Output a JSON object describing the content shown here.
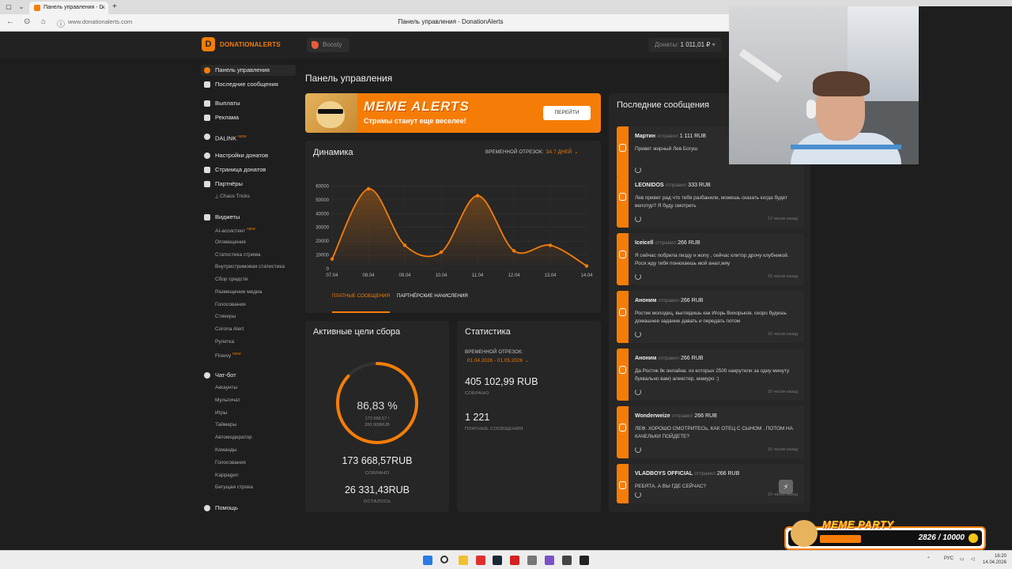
{
  "browser": {
    "tab_title": "Панель управления - D",
    "url": "www.donationalerts.com",
    "page_title": "Панель управления - DonationAlerts"
  },
  "topnav": {
    "logo": "DONATIONALERTS",
    "boosty": "Boosty",
    "donates_label": "Донаты:",
    "donates_value": "1 011,01 ₽"
  },
  "sidebar": {
    "items": [
      {
        "label": "Панель управления"
      },
      {
        "label": "Последние сообщения"
      },
      {
        "label": "Выплаты"
      },
      {
        "label": "Реклама"
      },
      {
        "label": "DALINK"
      },
      {
        "label": "Настройки донатов"
      },
      {
        "label": "Страница донатов"
      },
      {
        "label": "Партнёры"
      },
      {
        "label": "Виджеты"
      },
      {
        "label": "Чат-бот"
      },
      {
        "label": "Помощь"
      }
    ],
    "partners_sub": [
      "Chaos Tricks"
    ],
    "widgets_sub": [
      "AI-ассистент",
      "Оповещения",
      "Статистика стрима",
      "Внутристримовая статистика",
      "Сбор средств",
      "Размещение медиа",
      "Голосования",
      "Стикеры",
      "Corona Alert",
      "Рулетка",
      "Flowvy"
    ],
    "chatbot_sub": [
      "Аккаунты",
      "Мультичат",
      "Игры",
      "Таймеры",
      "Автомодератор",
      "Команды",
      "Голосования",
      "Kappagen",
      "Бегущая строка"
    ],
    "new_badge": "NEW"
  },
  "main": {
    "title": "Панель управления",
    "banner": {
      "title": "MEME ALERTS",
      "subtitle": "Стримы станут еще веселее!",
      "button": "ПЕРЕЙТИ"
    },
    "dynamics": {
      "title": "Динамика",
      "period_label": "ВРЕМЕННОЙ ОТРЕЗОК:",
      "period_value": "ЗА 7 ДНЕЙ",
      "tab_paid": "ПЛАТНЫЕ СООБЩЕНИЯ",
      "tab_partner": "ПАРТНЁРСКИЕ НАЧИСЛЕНИЯ"
    },
    "goals": {
      "title": "Активные цели сбора",
      "percent": "86,83 %",
      "progress": 0.8683,
      "ring_line1": "173 668,57 /",
      "ring_line2": "200 000RUB",
      "collected": "173 668,57RUB",
      "collected_label": "СОБРАНО",
      "left": "26 331,43RUB",
      "left_label": "ОСТАЛОСЬ"
    },
    "stats": {
      "title": "Статистика",
      "period_label": "ВРЕМЕННОЙ ОТРЕЗОК:",
      "period_value": "01.04.2026 - 01.05.2026",
      "collected": "405 102,99 RUB",
      "collected_label": "СОБРАНО",
      "messages": "1 221",
      "messages_label": "ПЛАТНЫЕ СООБЩЕНИЯ"
    }
  },
  "recent": {
    "title": "Последние сообщения",
    "verb": "отправил",
    "messages": [
      {
        "name": "Мартин",
        "amount": "1 111 RUB",
        "text": "Привет жирный Лев Богуш",
        "time": ""
      },
      {
        "name": "LEONIDOS",
        "amount": "333 RUB",
        "text": "Лев привет рад что тебя разбанили, можешь сказать когда будет велотур? Я буду смотреть",
        "time": "13 часов назад"
      },
      {
        "name": "Iceicell",
        "amount": "266 RUB",
        "text": "Я сейчас побрила пизду и жопу , сейчас клитор дрочу клубникой. Рося жду тебя понюхаешь мой анал,мяу",
        "time": "15 часов назад"
      },
      {
        "name": "Аноним",
        "amount": "266 RUB",
        "text": "Ростик молодец, выглядишь как Игорь Вихорьков. скоро будешь домашнее задание давать и передать потом",
        "time": "16 часов назад"
      },
      {
        "name": "Аноним",
        "amount": "266 RUB",
        "text": "Да Ростик 8к онлайна. из которых 2500 накрутили за одну минуту буквально вам) алекстер, мамуро :)",
        "time": "16 часов назад"
      },
      {
        "name": "Wonderweize",
        "amount": "266 RUB",
        "text": "ЛЕФ. ХОРОШО СМОТРИТЕСЬ, КАК ОТЕЦ С СЫНОМ . ПОТОМ НА КАЧЕЛЬКИ ПОЙДЕТЕ?",
        "time": "16 часов назад"
      },
      {
        "name": "VLADBOYS OFFICIAL",
        "amount": "266 RUB",
        "text": "РЕБЯТА, А ВЫ ГДЕ СЕЙЧАС?",
        "time": "16 часов назад"
      }
    ]
  },
  "overlay": {
    "title": "MEME PARTY",
    "count": "2826 / 10000",
    "progress": 0.2826
  },
  "taskbar": {
    "lang": "РУС",
    "time": "16:20",
    "date": "14.04.2026"
  },
  "chart_data": {
    "type": "line",
    "title": "Динамика",
    "categories": [
      "07.04",
      "08.04",
      "09.04",
      "10.04",
      "11.04",
      "12.04",
      "13.04",
      "14.04"
    ],
    "values": [
      7000,
      58000,
      17000,
      12000,
      53000,
      13000,
      17000,
      2000
    ],
    "yticks": [
      0,
      10000,
      20000,
      30000,
      40000,
      50000,
      60000
    ],
    "ylim": [
      0,
      62000
    ],
    "grid": true,
    "color": "#f57d07"
  },
  "colors": {
    "accent": "#f57d07",
    "background": "#1e1e1e",
    "card": "#262626"
  }
}
